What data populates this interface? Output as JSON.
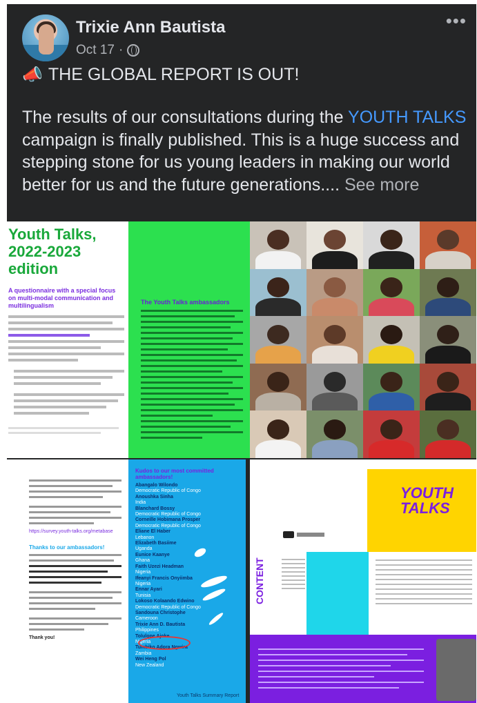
{
  "post": {
    "author": "Trixie Ann Bautista",
    "date": "Oct 17",
    "separator": "·",
    "privacy_icon": "globe-icon",
    "more_icon": "more-options-icon",
    "headline_icon": "megaphone-icon",
    "headline": "THE GLOBAL REPORT IS OUT!",
    "body_before": "The results of our consultations during the ",
    "body_link": "YOUTH TALKS",
    "body_after": " campaign is finally published. This is a huge success and stepping stone for us young leaders in making our world better for us and the future generations.... ",
    "see_more": "See more"
  },
  "images": {
    "page1": {
      "title": "Youth Talks, 2022-2023 edition",
      "subtitle": "A questionnaire with a special focus on multi-modal communication and multilingualism"
    },
    "page2": {
      "heading": "The Youth Talks ambassadors"
    },
    "page4": {
      "heading": "Thanks to our ambassadors!",
      "link": "https://survey.youth-talks.org/metabase",
      "closing": "Thank you!"
    },
    "page5": {
      "heading": "Kudos to our most committed ambassadors!",
      "names": [
        "Abangalo Wilondo",
        "Anoushka Sinha",
        "Blanchard Bossy",
        "Corneille Hobimana Prosper",
        "Eliane El Haber",
        "Elizabeth Basiime",
        "Eunice Kaanye",
        "Faith Uzezi Headman",
        "Ifeanyi Francis Onyiimba",
        "Ennar Ayari",
        "Lokoso Kolaando Edwino",
        "Sandouna Christophe",
        "Trixie Ann D. Bautista",
        "Tolulope Ajoke",
        "Tumbiko Adora Ngwira",
        "Wei Heng Pol"
      ],
      "countries": [
        "Democratic Republic of Congo",
        "India",
        "Democratic Republic of Congo",
        "Democratic Republic of Congo",
        "Lebanon",
        "Uganda",
        "Ghana",
        "Nigeria",
        "Nigeria",
        "Tunisia",
        "Democratic Republic of Congo",
        "Cameroon",
        "Philippines",
        "Nigeria",
        "Zambia",
        "New Zealand"
      ],
      "footer": "Youth Talks Summary Report"
    },
    "page6": {
      "logo": "YOUTH TALKS",
      "content_label": "CONTENT"
    }
  },
  "colors": {
    "post_bg": "#242526",
    "text": "#e4e6eb",
    "secondary": "#b0b3b8",
    "link": "#4599ff",
    "green": "#2ce04f",
    "cyan": "#1aa8e8",
    "yellow": "#ffd400",
    "violet": "#7b1fe0"
  }
}
